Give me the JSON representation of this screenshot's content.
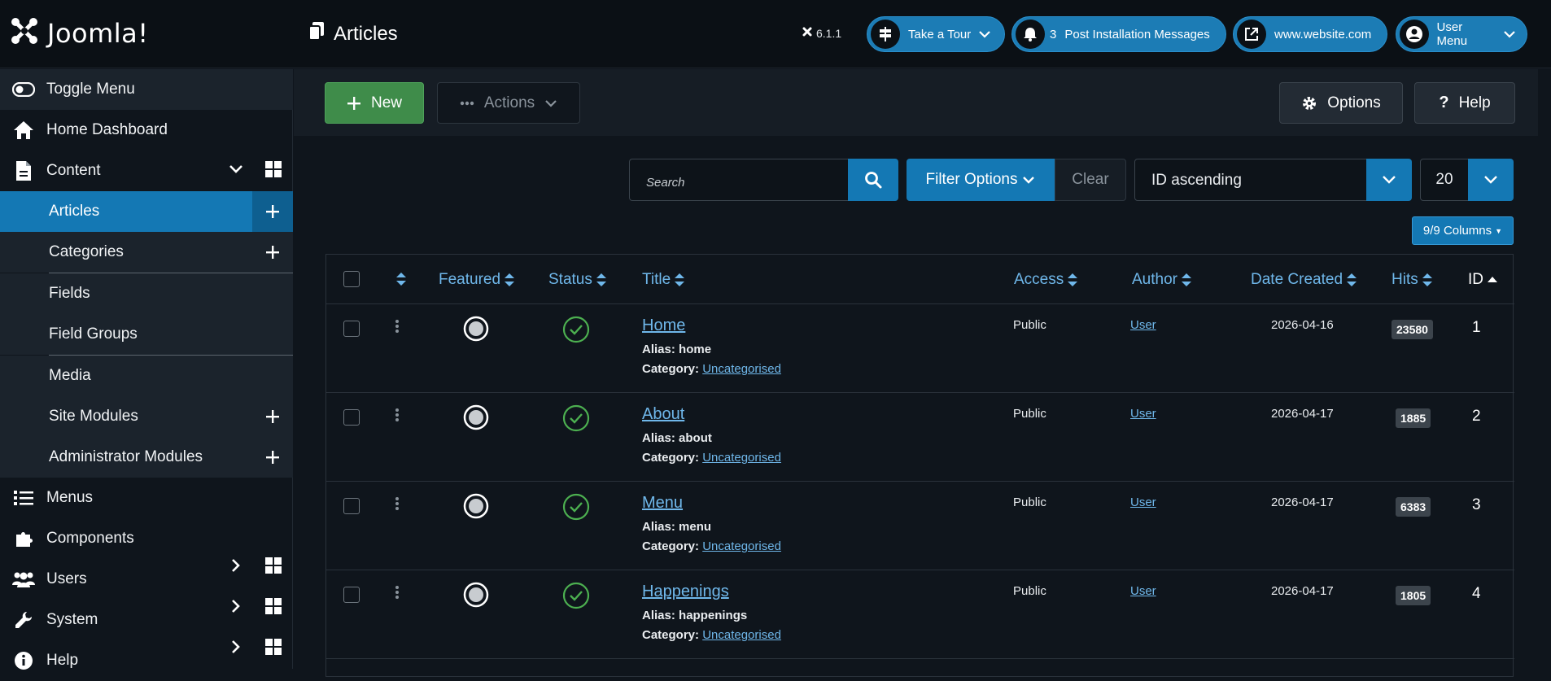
{
  "header": {
    "logo_text": "Joomla!",
    "page_title": "Articles",
    "version": "6.1.1",
    "tour_label": "Take a Tour",
    "messages_count": "3",
    "messages_label": "Post Installation Messages",
    "site_label": "www.website.com",
    "user_menu_label": "User Menu"
  },
  "sidebar": {
    "toggle": "Toggle Menu",
    "home": "Home Dashboard",
    "content": "Content",
    "articles": "Articles",
    "categories": "Categories",
    "fields": "Fields",
    "field_groups": "Field Groups",
    "media": "Media",
    "site_modules": "Site Modules",
    "admin_modules": "Administrator Modules",
    "menus": "Menus",
    "components": "Components",
    "users": "Users",
    "system": "System",
    "help": "Help"
  },
  "toolbar": {
    "new_label": "New",
    "actions_label": "Actions",
    "options_label": "Options",
    "help_label": "Help"
  },
  "filters": {
    "search_placeholder": "Search",
    "filter_options": "Filter Options",
    "clear": "Clear",
    "sort_value": "ID ascending",
    "limit_value": "20",
    "columns_label": "9/9 Columns"
  },
  "table": {
    "headers": {
      "featured": "Featured",
      "status": "Status",
      "title": "Title",
      "access": "Access",
      "author": "Author",
      "date_created": "Date Created",
      "hits": "Hits",
      "id": "ID"
    },
    "alias_label": "Alias:",
    "category_label": "Category:",
    "rows": [
      {
        "title": "Home",
        "alias": "home",
        "category": "Uncategorised",
        "access": "Public",
        "author": "User",
        "date": "2026-04-16",
        "hits": "23580",
        "id": "1"
      },
      {
        "title": "About",
        "alias": "about",
        "category": "Uncategorised",
        "access": "Public",
        "author": "User",
        "date": "2026-04-17",
        "hits": "1885",
        "id": "2"
      },
      {
        "title": "Menu",
        "alias": "menu",
        "category": "Uncategorised",
        "access": "Public",
        "author": "User",
        "date": "2026-04-17",
        "hits": "6383",
        "id": "3"
      },
      {
        "title": "Happenings",
        "alias": "happenings",
        "category": "Uncategorised",
        "access": "Public",
        "author": "User",
        "date": "2026-04-17",
        "hits": "1805",
        "id": "4"
      }
    ]
  },
  "colors": {
    "primary": "#1478b4",
    "success": "#3f8c4a",
    "link": "#6fb7ea",
    "background": "#0f151c"
  },
  "icons": {
    "logo": "joomla-logo-icon",
    "page": "copy-icon",
    "tour": "signpost-icon",
    "bell": "bell-icon",
    "external": "external-link-icon",
    "user": "user-circle-icon"
  }
}
